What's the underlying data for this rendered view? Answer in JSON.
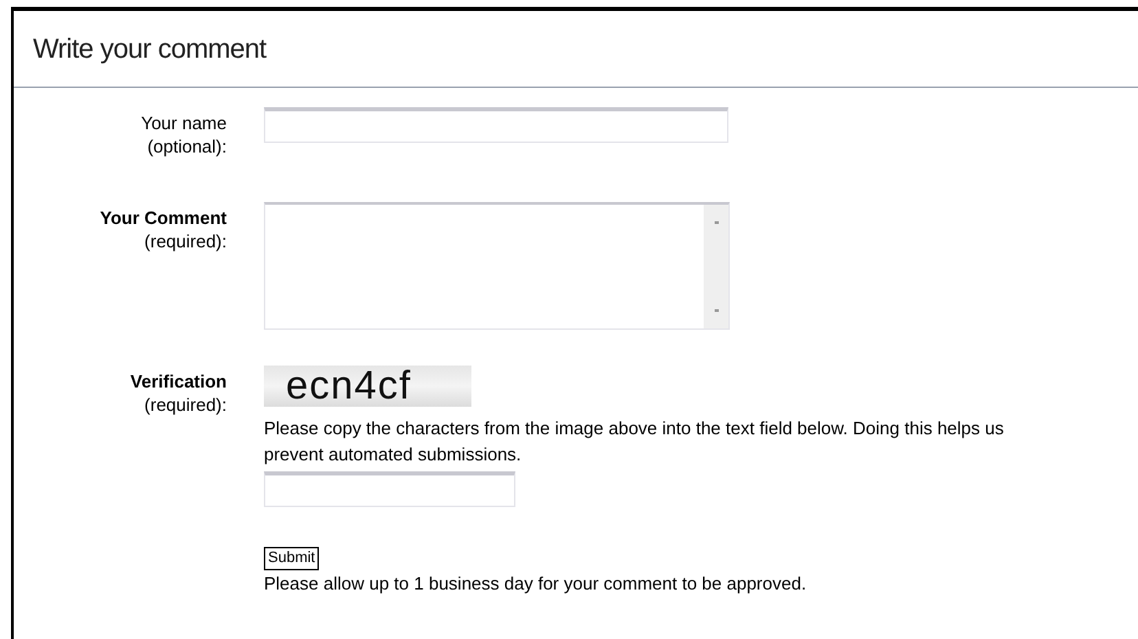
{
  "heading": "Write your comment",
  "fields": [
    {
      "kind": "text",
      "label": "Your name",
      "label_bold": false,
      "note": "(optional):"
    },
    {
      "kind": "textarea",
      "label": "Your Comment",
      "label_bold": true,
      "note": "(required):"
    },
    {
      "kind": "captcha",
      "label": "Verification",
      "label_bold": true,
      "note": "(required):",
      "captcha_text": "ecn4cf",
      "help": "Please copy the characters from the image above into the text field below. Doing this helps us prevent automated submissions."
    }
  ],
  "submit": "Submit",
  "footer_note": "Please allow up to 1 business day for your comment to be approved."
}
